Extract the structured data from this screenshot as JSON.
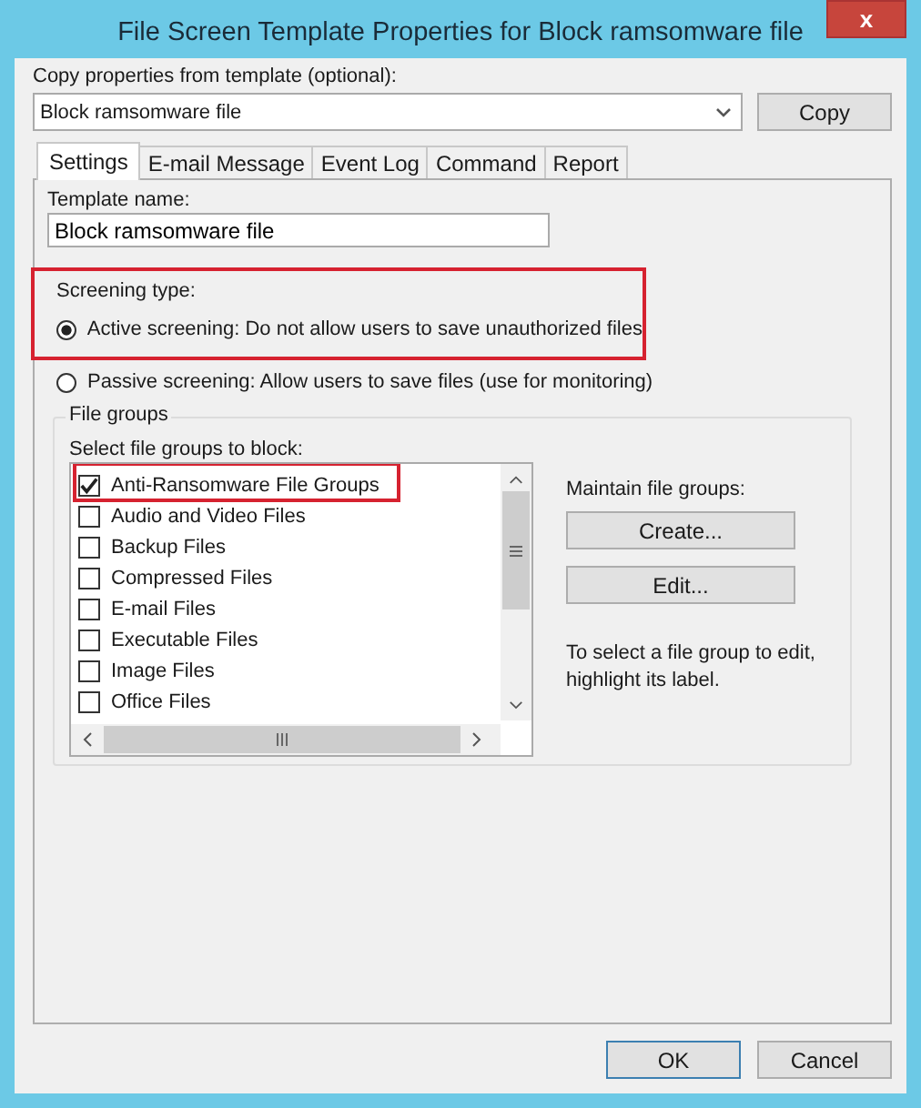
{
  "window": {
    "title": "File Screen Template Properties for Block ramsomware file",
    "close": "x"
  },
  "copy_from": {
    "label": "Copy properties from template (optional):",
    "value": "Block ramsomware file",
    "button": "Copy"
  },
  "tabs": [
    {
      "label": "Settings",
      "selected": true
    },
    {
      "label": "E-mail Message",
      "selected": false
    },
    {
      "label": "Event Log",
      "selected": false
    },
    {
      "label": "Command",
      "selected": false
    },
    {
      "label": "Report",
      "selected": false
    }
  ],
  "template_name": {
    "label": "Template name:",
    "value": "Block ramsomware file"
  },
  "screening_type": {
    "label": "Screening type:",
    "highlighted": true,
    "options": [
      {
        "label": "Active screening: Do not allow users to save unauthorized files",
        "selected": true
      },
      {
        "label": "Passive screening: Allow users to save files (use for monitoring)",
        "selected": false
      }
    ]
  },
  "file_groups": {
    "title": "File groups",
    "list_label": "Select file groups to block:",
    "items": [
      {
        "label": "Anti-Ransomware File Groups",
        "checked": true,
        "highlighted": true
      },
      {
        "label": "Audio and Video Files",
        "checked": false,
        "highlighted": false
      },
      {
        "label": "Backup Files",
        "checked": false,
        "highlighted": false
      },
      {
        "label": "Compressed Files",
        "checked": false,
        "highlighted": false
      },
      {
        "label": "E-mail Files",
        "checked": false,
        "highlighted": false
      },
      {
        "label": "Executable Files",
        "checked": false,
        "highlighted": false
      },
      {
        "label": "Image Files",
        "checked": false,
        "highlighted": false
      },
      {
        "label": "Office Files",
        "checked": false,
        "highlighted": false
      }
    ],
    "maintain_label": "Maintain file groups:",
    "buttons": [
      "Create...",
      "Edit..."
    ],
    "hint": "To select a file group to edit, highlight its label."
  },
  "buttons": [
    "OK",
    "Cancel"
  ]
}
